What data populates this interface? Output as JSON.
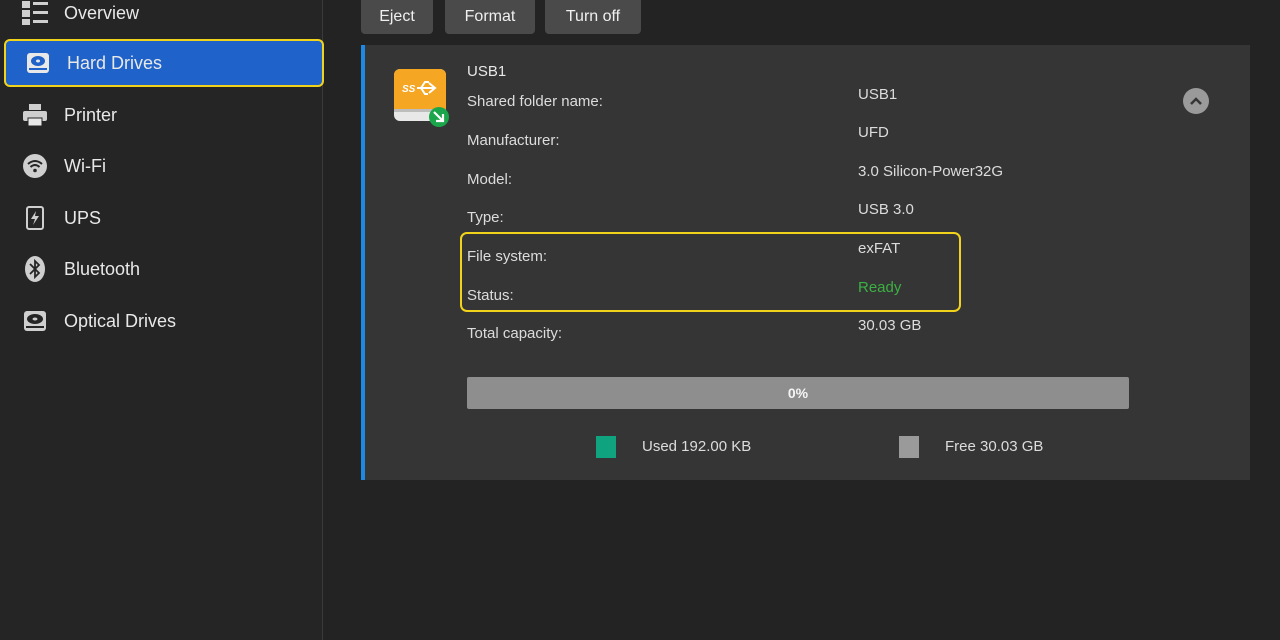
{
  "sidebar": {
    "items": [
      {
        "label": "Overview",
        "icon": "overview-icon"
      },
      {
        "label": "Hard Drives",
        "icon": "hard-drive-icon",
        "active": true
      },
      {
        "label": "Printer",
        "icon": "printer-icon"
      },
      {
        "label": "Wi-Fi",
        "icon": "wifi-icon"
      },
      {
        "label": "UPS",
        "icon": "ups-battery-icon"
      },
      {
        "label": "Bluetooth",
        "icon": "bluetooth-icon"
      },
      {
        "label": "Optical Drives",
        "icon": "optical-drive-icon"
      }
    ]
  },
  "toolbar": {
    "eject_label": "Eject",
    "format_label": "Format",
    "turnoff_label": "Turn off"
  },
  "drive": {
    "name": "USB1",
    "icon": "usb-drive-icon",
    "properties": [
      {
        "label": "Shared folder name:",
        "value": "USB1"
      },
      {
        "label": "Manufacturer:",
        "value": "UFD"
      },
      {
        "label": "Model:",
        "value": "3.0 Silicon-Power32G"
      },
      {
        "label": "Type:",
        "value": "USB 3.0"
      },
      {
        "label": "File system:",
        "value": "exFAT"
      },
      {
        "label": "Status:",
        "value": "Ready"
      },
      {
        "label": "Total capacity:",
        "value": "30.03 GB"
      }
    ],
    "usage_percent_label": "0%",
    "usage_fraction": 0.0,
    "legend": {
      "used_label": "Used 192.00 KB",
      "free_label": "Free 30.03 GB"
    }
  },
  "colors": {
    "accent": "#1f62c9",
    "highlight": "#f2d31b",
    "status_ready": "#3cb043",
    "used": "#0fa37f",
    "free": "#9a9a9a"
  }
}
